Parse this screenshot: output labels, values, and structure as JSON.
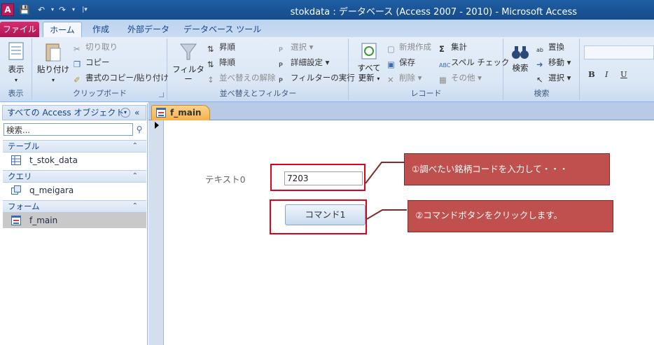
{
  "window": {
    "title": "stokdata : データベース (Access 2007 - 2010)  -  Microsoft Access",
    "app_icon_letter": "A"
  },
  "ribbon_tabs": [
    "ファイル",
    "ホーム",
    "作成",
    "外部データ",
    "データベース ツール"
  ],
  "ribbon": {
    "view": {
      "button": "表示",
      "group": "表示"
    },
    "clipboard": {
      "paste": "貼り付け",
      "cut": "切り取り",
      "copy": "コピー",
      "format_painter": "書式のコピー/貼り付け",
      "group": "クリップボード"
    },
    "sort_filter": {
      "filter": "フィルター",
      "ascending": "昇順",
      "descending": "降順",
      "remove_sort": "並べ替えの解除",
      "selection": "選択",
      "advanced": "詳細設定",
      "toggle_filter": "フィルターの実行",
      "group": "並べ替えとフィルター"
    },
    "records": {
      "refresh_all_1": "すべて",
      "refresh_all_2": "更新",
      "new": "新規作成",
      "save": "保存",
      "delete": "削除",
      "totals": "集計",
      "spelling": "スペル チェック",
      "more": "その他",
      "group": "レコード"
    },
    "find": {
      "find": "検索",
      "replace": "置換",
      "goto": "移動",
      "select": "選択",
      "group": "検索"
    },
    "text_format": {
      "bold": "B",
      "italic": "I",
      "underline": "U"
    }
  },
  "nav": {
    "header": "すべての Access オブジェクト",
    "search_placeholder": "検索...",
    "sections": [
      {
        "label": "テーブル",
        "items": [
          "t_stok_data"
        ]
      },
      {
        "label": "クエリ",
        "items": [
          "q_meigara"
        ]
      },
      {
        "label": "フォーム",
        "items": [
          "f_main"
        ]
      }
    ]
  },
  "document": {
    "tab_label": "f_main",
    "text_label": "テキスト0",
    "text_value": "7203",
    "button_label": "コマンド1"
  },
  "callouts": {
    "step1": "①調べたい銘柄コードを入力して・・・",
    "step2": "②コマンドボタンをクリックします。"
  },
  "colors": {
    "title_bar": "#1a5597",
    "file_tab": "#c2185b",
    "callout_fill": "#c0504d",
    "highlight_border": "#e0001b",
    "doc_tab": "#f6b14d"
  }
}
